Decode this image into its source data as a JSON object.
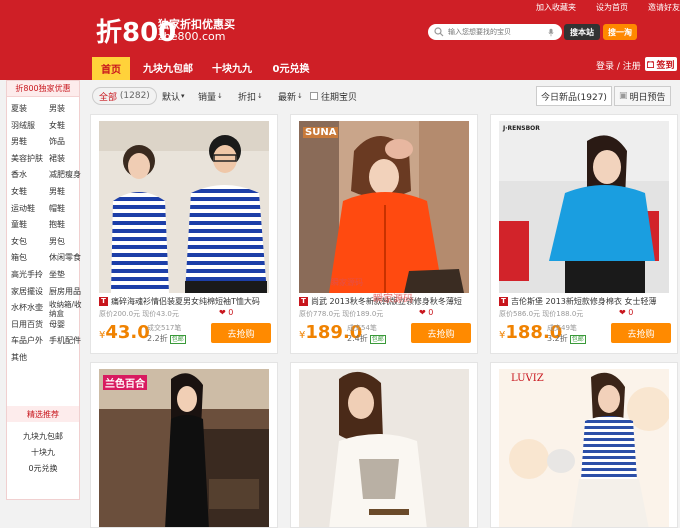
{
  "header": {
    "logo_char": "折800",
    "slogan": "独家折扣优惠买",
    "domain": "zhe800.com",
    "top_links": [
      "加入收藏夹",
      "设为首页",
      "邀请好友"
    ],
    "search_placeholder": "输入您想要找的宝贝",
    "btn_site": "搜本站",
    "btn_search": "搜一淘",
    "login": "登录 / 注册",
    "signin": "签到"
  },
  "nav": [
    "首页",
    "九块九包邮",
    "十块九九",
    "0元兑换"
  ],
  "sidebar": {
    "head": "折800独家优惠",
    "categories": [
      "夏装",
      "男装",
      "羽绒服",
      "女鞋",
      "男鞋",
      "饰品",
      "美容护肤",
      "裙装",
      "香水",
      "减肥瘦身",
      "女鞋",
      "男鞋",
      "运动鞋",
      "帽鞋",
      "童鞋",
      "抱鞋",
      "女包",
      "男包",
      "箱包",
      "休闲零食",
      "高光手拎",
      "坐垫",
      "家居擺设",
      "厨房用品",
      "水杯水壶",
      "收纳箱/收纳盒",
      "日用百货",
      "母婴",
      "车品户外",
      "手机配件",
      "其他"
    ],
    "rec_head": "精选推荐",
    "rec_items": [
      "九块九包邮",
      "十块九",
      "0元兑换"
    ]
  },
  "filters": {
    "all_label": "全部",
    "all_count": "(1282)",
    "items": [
      "默认",
      "销量",
      "折扣",
      "最新",
      "往期宝贝"
    ],
    "today_label": "今日新品(1927)",
    "tomorrow_label": "明日预告"
  },
  "products": [
    {
      "title": "痛碎海魂衫情侣装夏男女纯棉短袖T恤大码",
      "orig": "原价200.0元 现价43.0元",
      "price": "43.0",
      "sold": "成交517笔",
      "rate": "2.2折",
      "buy": "去抢购"
    },
    {
      "title": "尚武 2013秋冬新款韩版立领修身秋冬薄短",
      "orig": "原价778.0元 现价189.0元",
      "price": "189.0",
      "sold": "成交54笔",
      "rate": "2.4折",
      "buy": "去抢购"
    },
    {
      "title": "吉伦斯堡 2013新短款修身棉衣 女士轻薄",
      "orig": "原价586.0元 现价188.0元",
      "price": "188.0",
      "sold": "成交49笔",
      "rate": "3.2折",
      "buy": "去抢购"
    }
  ],
  "labels": {
    "baoyou": "包邮",
    "yen": "¥"
  },
  "watermarks": {
    "w1": "瞬家源码",
    "w2": "瞬家源码",
    "brand2": "SUNA",
    "brand3": "J·RENSBOR",
    "brand4": "兰色百合",
    "brand6": "LUVIZ"
  },
  "colors": {
    "brand_red": "#cf1f26",
    "nav_active": "#ffd23a",
    "price_orange": "#f08200",
    "buy_button": "#ff8a00"
  }
}
